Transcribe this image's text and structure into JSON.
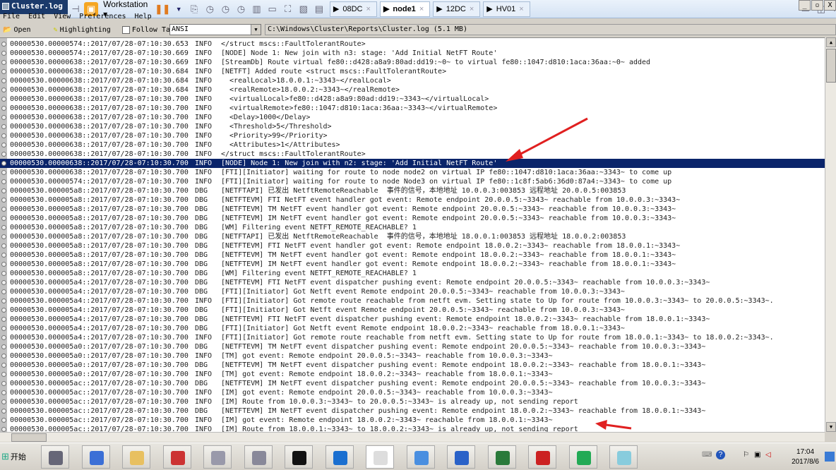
{
  "window": {
    "title": "Cluster.log"
  },
  "vm_toolbar": {
    "vm_name": "Workstation",
    "tabs": [
      {
        "label": "08DC"
      },
      {
        "label": "node1",
        "active": true
      },
      {
        "label": "12DC"
      },
      {
        "label": "HV01"
      }
    ],
    "close_glyph": "×"
  },
  "menu": [
    "File",
    "Edit",
    "View",
    "Preferences",
    "Help"
  ],
  "toolbar": {
    "open": "Open",
    "highlighting": "Highlighting",
    "follow_tail": "Follow Tail",
    "follow_tail_checked": false,
    "encoding": "ANSI",
    "path": "C:\\Windows\\Cluster\\Reports\\Cluster.log (5.1 MB)"
  },
  "log": {
    "selected_index": 13,
    "rows": [
      {
        "prefix": "00000530.00000574::2017/07/28-07:10:30.653",
        "level": "INFO",
        "msg": "</struct mscs::FaultTolerantRoute>"
      },
      {
        "prefix": "00000530.00000574::2017/07/28-07:10:30.669",
        "level": "INFO",
        "msg": "[NODE] Node 1: New join with n3: stage: 'Add Initial NetFT Route'"
      },
      {
        "prefix": "00000530.00000638::2017/07/28-07:10:30.669",
        "level": "INFO",
        "msg": "[StreamDb] Route virtual fe80::d428:a8a9:80ad:dd19:~0~ to virtual fe80::1047:d810:1aca:36aa:~0~ added"
      },
      {
        "prefix": "00000530.00000638::2017/07/28-07:10:30.684",
        "level": "INFO",
        "msg": "[NETFT] Added route <struct mscs::FaultTolerantRoute>"
      },
      {
        "prefix": "00000530.00000638::2017/07/28-07:10:30.684",
        "level": "INFO",
        "msg": "  <realLocal>18.0.0.1:~3343~</realLocal>"
      },
      {
        "prefix": "00000530.00000638::2017/07/28-07:10:30.684",
        "level": "INFO",
        "msg": "  <realRemote>18.0.0.2:~3343~</realRemote>"
      },
      {
        "prefix": "00000530.00000638::2017/07/28-07:10:30.700",
        "level": "INFO",
        "msg": "  <virtualLocal>fe80::d428:a8a9:80ad:dd19:~3343~</virtualLocal>"
      },
      {
        "prefix": "00000530.00000638::2017/07/28-07:10:30.700",
        "level": "INFO",
        "msg": "  <virtualRemote>fe80::1047:d810:1aca:36aa:~3343~</virtualRemote>"
      },
      {
        "prefix": "00000530.00000638::2017/07/28-07:10:30.700",
        "level": "INFO",
        "msg": "  <Delay>1000</Delay>"
      },
      {
        "prefix": "00000530.00000638::2017/07/28-07:10:30.700",
        "level": "INFO",
        "msg": "  <Threshold>5</Threshold>"
      },
      {
        "prefix": "00000530.00000638::2017/07/28-07:10:30.700",
        "level": "INFO",
        "msg": "  <Priority>99</Priority>"
      },
      {
        "prefix": "00000530.00000638::2017/07/28-07:10:30.700",
        "level": "INFO",
        "msg": "  <Attributes>1</Attributes>"
      },
      {
        "prefix": "00000530.00000638::2017/07/28-07:10:30.700",
        "level": "INFO",
        "msg": "</struct mscs::FaultTolerantRoute>"
      },
      {
        "prefix": "00000530.00000638::2017/07/28-07:10:30.700",
        "level": "INFO",
        "msg": "[NODE] Node 1: New join with n2: stage: 'Add Initial NetFT Route'"
      },
      {
        "prefix": "00000530.00000638::2017/07/28-07:10:30.700",
        "level": "INFO",
        "msg": "[FTI][Initiator] waiting for route to node node2 on virtual IP fe80::1047:d810:1aca:36aa:~3343~ to come up"
      },
      {
        "prefix": "00000530.00000574::2017/07/28-07:10:30.700",
        "level": "INFO",
        "msg": "[FTI][Initiator] waiting for route to node Node3 on virtual IP fe80::1c8f:5ab6:36d0:87a4:~3343~ to come up"
      },
      {
        "prefix": "00000530.000005a8::2017/07/28-07:10:30.700",
        "level": "DBG",
        "msg": "[NETFTAPI] 已发出 NetftRemoteReachable  事件的信号，本地地址 10.0.0.3:003853 远程地址 20.0.0.5:003853"
      },
      {
        "prefix": "00000530.000005a8::2017/07/28-07:10:30.700",
        "level": "DBG",
        "msg": "[NETFTEVM] FTI NetFT event handler got event: Remote endpoint 20.0.0.5:~3343~ reachable from 10.0.0.3:~3343~"
      },
      {
        "prefix": "00000530.000005a8::2017/07/28-07:10:30.700",
        "level": "DBG",
        "msg": "[NETFTEVM] TM NetFT event handler got event: Remote endpoint 20.0.0.5:~3343~ reachable from 10.0.0.3:~3343~"
      },
      {
        "prefix": "00000530.000005a8::2017/07/28-07:10:30.700",
        "level": "DBG",
        "msg": "[NETFTEVM] IM NetFT event handler got event: Remote endpoint 20.0.0.5:~3343~ reachable from 10.0.0.3:~3343~"
      },
      {
        "prefix": "00000530.000005a8::2017/07/28-07:10:30.700",
        "level": "DBG",
        "msg": "[WM] Filtering event NETFT_REMOTE_REACHABLE? 1"
      },
      {
        "prefix": "00000530.000005a8::2017/07/28-07:10:30.700",
        "level": "DBG",
        "msg": "[NETFTAPI] 已发出 NetftRemoteReachable  事件的信号，本地地址 18.0.0.1:003853 远程地址 18.0.0.2:003853"
      },
      {
        "prefix": "00000530.000005a8::2017/07/28-07:10:30.700",
        "level": "DBG",
        "msg": "[NETFTEVM] FTI NetFT event handler got event: Remote endpoint 18.0.0.2:~3343~ reachable from 18.0.0.1:~3343~"
      },
      {
        "prefix": "00000530.000005a8::2017/07/28-07:10:30.700",
        "level": "DBG",
        "msg": "[NETFTEVM] TM NetFT event handler got event: Remote endpoint 18.0.0.2:~3343~ reachable from 18.0.0.1:~3343~"
      },
      {
        "prefix": "00000530.000005a8::2017/07/28-07:10:30.700",
        "level": "DBG",
        "msg": "[NETFTEVM] IM NetFT event handler got event: Remote endpoint 18.0.0.2:~3343~ reachable from 18.0.0.1:~3343~"
      },
      {
        "prefix": "00000530.000005a8::2017/07/28-07:10:30.700",
        "level": "DBG",
        "msg": "[WM] Filtering event NETFT_REMOTE_REACHABLE? 1"
      },
      {
        "prefix": "00000530.000005a4::2017/07/28-07:10:30.700",
        "level": "DBG",
        "msg": "[NETFTEVM] FTI NetFT event dispatcher pushing event: Remote endpoint 20.0.0.5:~3343~ reachable from 10.0.0.3:~3343~"
      },
      {
        "prefix": "00000530.000005a4::2017/07/28-07:10:30.700",
        "level": "DBG",
        "msg": "[FTI][Initiator] Got Netft event Remote endpoint 20.0.0.5:~3343~ reachable from 10.0.0.3:~3343~"
      },
      {
        "prefix": "00000530.000005a4::2017/07/28-07:10:30.700",
        "level": "INFO",
        "msg": "[FTI][Initiator] Got remote route reachable from netft evm. Setting state to Up for route from 10.0.0.3:~3343~ to 20.0.0.5:~3343~."
      },
      {
        "prefix": "00000530.000005a4::2017/07/28-07:10:30.700",
        "level": "DBG",
        "msg": "[FTI][Initiator] Got Netft event Remote endpoint 20.0.0.5:~3343~ reachable from 10.0.0.3:~3343~"
      },
      {
        "prefix": "00000530.000005a4::2017/07/28-07:10:30.700",
        "level": "DBG",
        "msg": "[NETFTEVM] FTI NetFT event dispatcher pushing event: Remote endpoint 18.0.0.2:~3343~ reachable from 18.0.0.1:~3343~"
      },
      {
        "prefix": "00000530.000005a4::2017/07/28-07:10:30.700",
        "level": "DBG",
        "msg": "[FTI][Initiator] Got Netft event Remote endpoint 18.0.0.2:~3343~ reachable from 18.0.0.1:~3343~"
      },
      {
        "prefix": "00000530.000005a4::2017/07/28-07:10:30.700",
        "level": "INFO",
        "msg": "[FTI][Initiator] Got remote route reachable from netft evm. Setting state to Up for route from 18.0.0.1:~3343~ to 18.0.0.2:~3343~."
      },
      {
        "prefix": "00000530.000005a0::2017/07/28-07:10:30.700",
        "level": "DBG",
        "msg": "[NETFTEVM] TM NetFT event dispatcher pushing event: Remote endpoint 20.0.0.5:~3343~ reachable from 10.0.0.3:~3343~"
      },
      {
        "prefix": "00000530.000005a0::2017/07/28-07:10:30.700",
        "level": "INFO",
        "msg": "[TM] got event: Remote endpoint 20.0.0.5:~3343~ reachable from 10.0.0.3:~3343~"
      },
      {
        "prefix": "00000530.000005a0::2017/07/28-07:10:30.700",
        "level": "DBG",
        "msg": "[NETFTEVM] TM NetFT event dispatcher pushing event: Remote endpoint 18.0.0.2:~3343~ reachable from 18.0.0.1:~3343~"
      },
      {
        "prefix": "00000530.000005a0::2017/07/28-07:10:30.700",
        "level": "INFO",
        "msg": "[TM] got event: Remote endpoint 18.0.0.2:~3343~ reachable from 18.0.0.1:~3343~"
      },
      {
        "prefix": "00000530.000005ac::2017/07/28-07:10:30.700",
        "level": "DBG",
        "msg": "[NETFTEVM] IM NetFT event dispatcher pushing event: Remote endpoint 20.0.0.5:~3343~ reachable from 10.0.0.3:~3343~"
      },
      {
        "prefix": "00000530.000005ac::2017/07/28-07:10:30.700",
        "level": "INFO",
        "msg": "[IM] got event: Remote endpoint 20.0.0.5:~3343~ reachable from 10.0.0.3:~3343~"
      },
      {
        "prefix": "00000530.000005ac::2017/07/28-07:10:30.700",
        "level": "INFO",
        "msg": "[IM] Route from 10.0.0.3:~3343~ to 20.0.0.5:~3343~ is already up, not sending report"
      },
      {
        "prefix": "00000530.000005ac::2017/07/28-07:10:30.700",
        "level": "DBG",
        "msg": "[NETFTEVM] IM NetFT event dispatcher pushing event: Remote endpoint 18.0.0.2:~3343~ reachable from 18.0.0.1:~3343~"
      },
      {
        "prefix": "00000530.000005ac::2017/07/28-07:10:30.700",
        "level": "INFO",
        "msg": "[IM] got event: Remote endpoint 18.0.0.2:~3343~ reachable from 18.0.0.1:~3343~"
      },
      {
        "prefix": "00000530.000005ac::2017/07/28-07:10:30.700",
        "level": "INFO",
        "msg": "[IM] Route from 18.0.0.1:~3343~ to 18.0.0.2:~3343~ is already up, not sending report"
      }
    ]
  },
  "annotation_color": "#e02020",
  "selection_color": "#0a246a",
  "taskbar": {
    "start": "开始",
    "apps": [
      "server-manager",
      "powershell",
      "explorer",
      "clock",
      "security",
      "tools",
      "cmd",
      "internet-explorer",
      "log-viewer",
      "control-panel",
      "powershell-admin",
      "network",
      "toolbox",
      "monitor",
      "notepad"
    ],
    "time": "17:04",
    "date": "2017/8/6"
  }
}
